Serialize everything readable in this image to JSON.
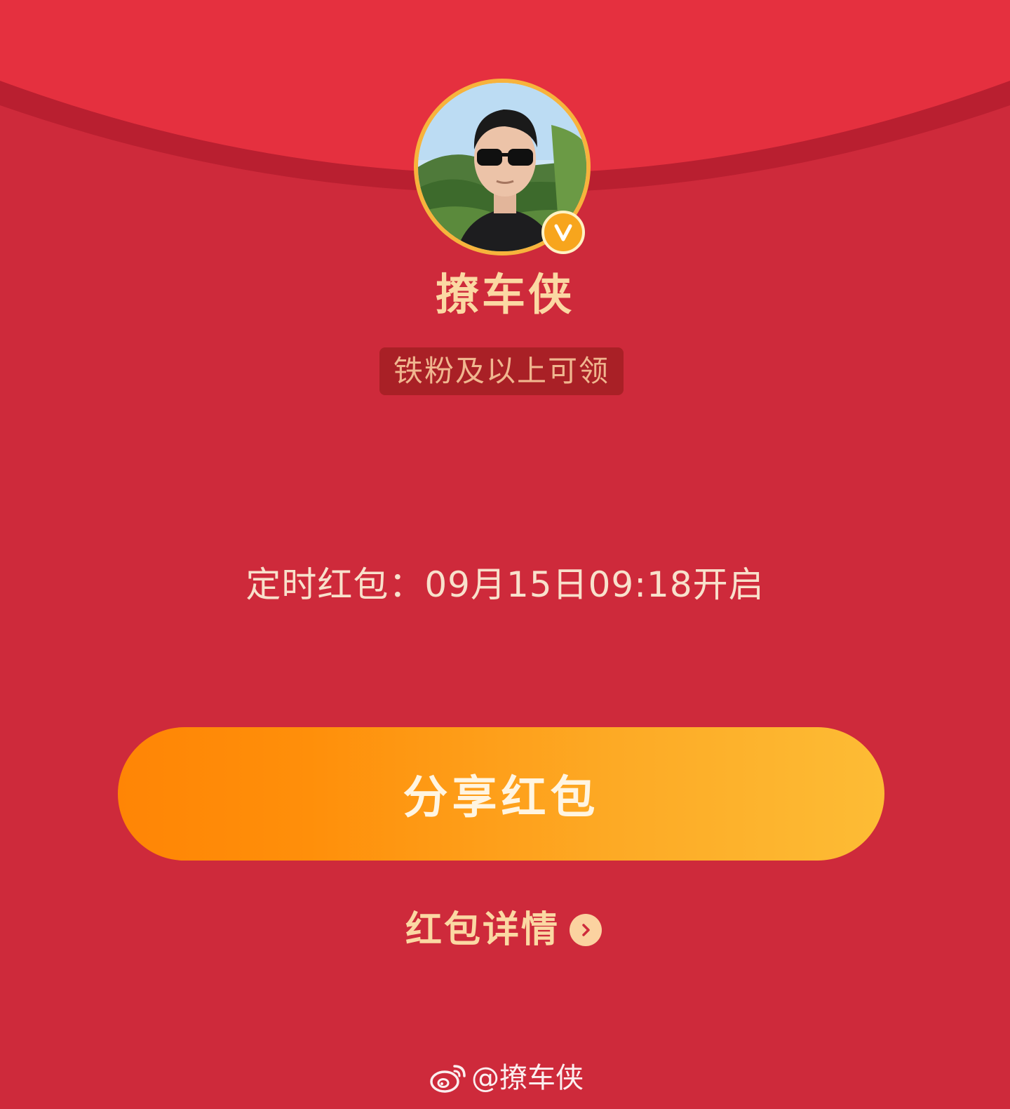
{
  "sender": {
    "name": "撩车侠",
    "verified": true
  },
  "eligibility_tag": "铁粉及以上可领",
  "timer": {
    "text": "定时红包：09月15日09:18开启"
  },
  "share_button": {
    "label": "分享红包"
  },
  "details_link": {
    "label": "红包详情"
  },
  "watermark": {
    "text": "@撩车侠"
  },
  "colors": {
    "background": "#ce2a3b",
    "flap": "#e5303f",
    "gold_text": "#fbd8a3",
    "tag_bg": "#a92026",
    "button_gradient_start": "#ff8505",
    "button_gradient_end": "#fdbc35"
  },
  "icons": {
    "verified": "verified-v-icon",
    "details_chevron": "chevron-right-icon",
    "watermark_logo": "weibo-logo-icon"
  }
}
